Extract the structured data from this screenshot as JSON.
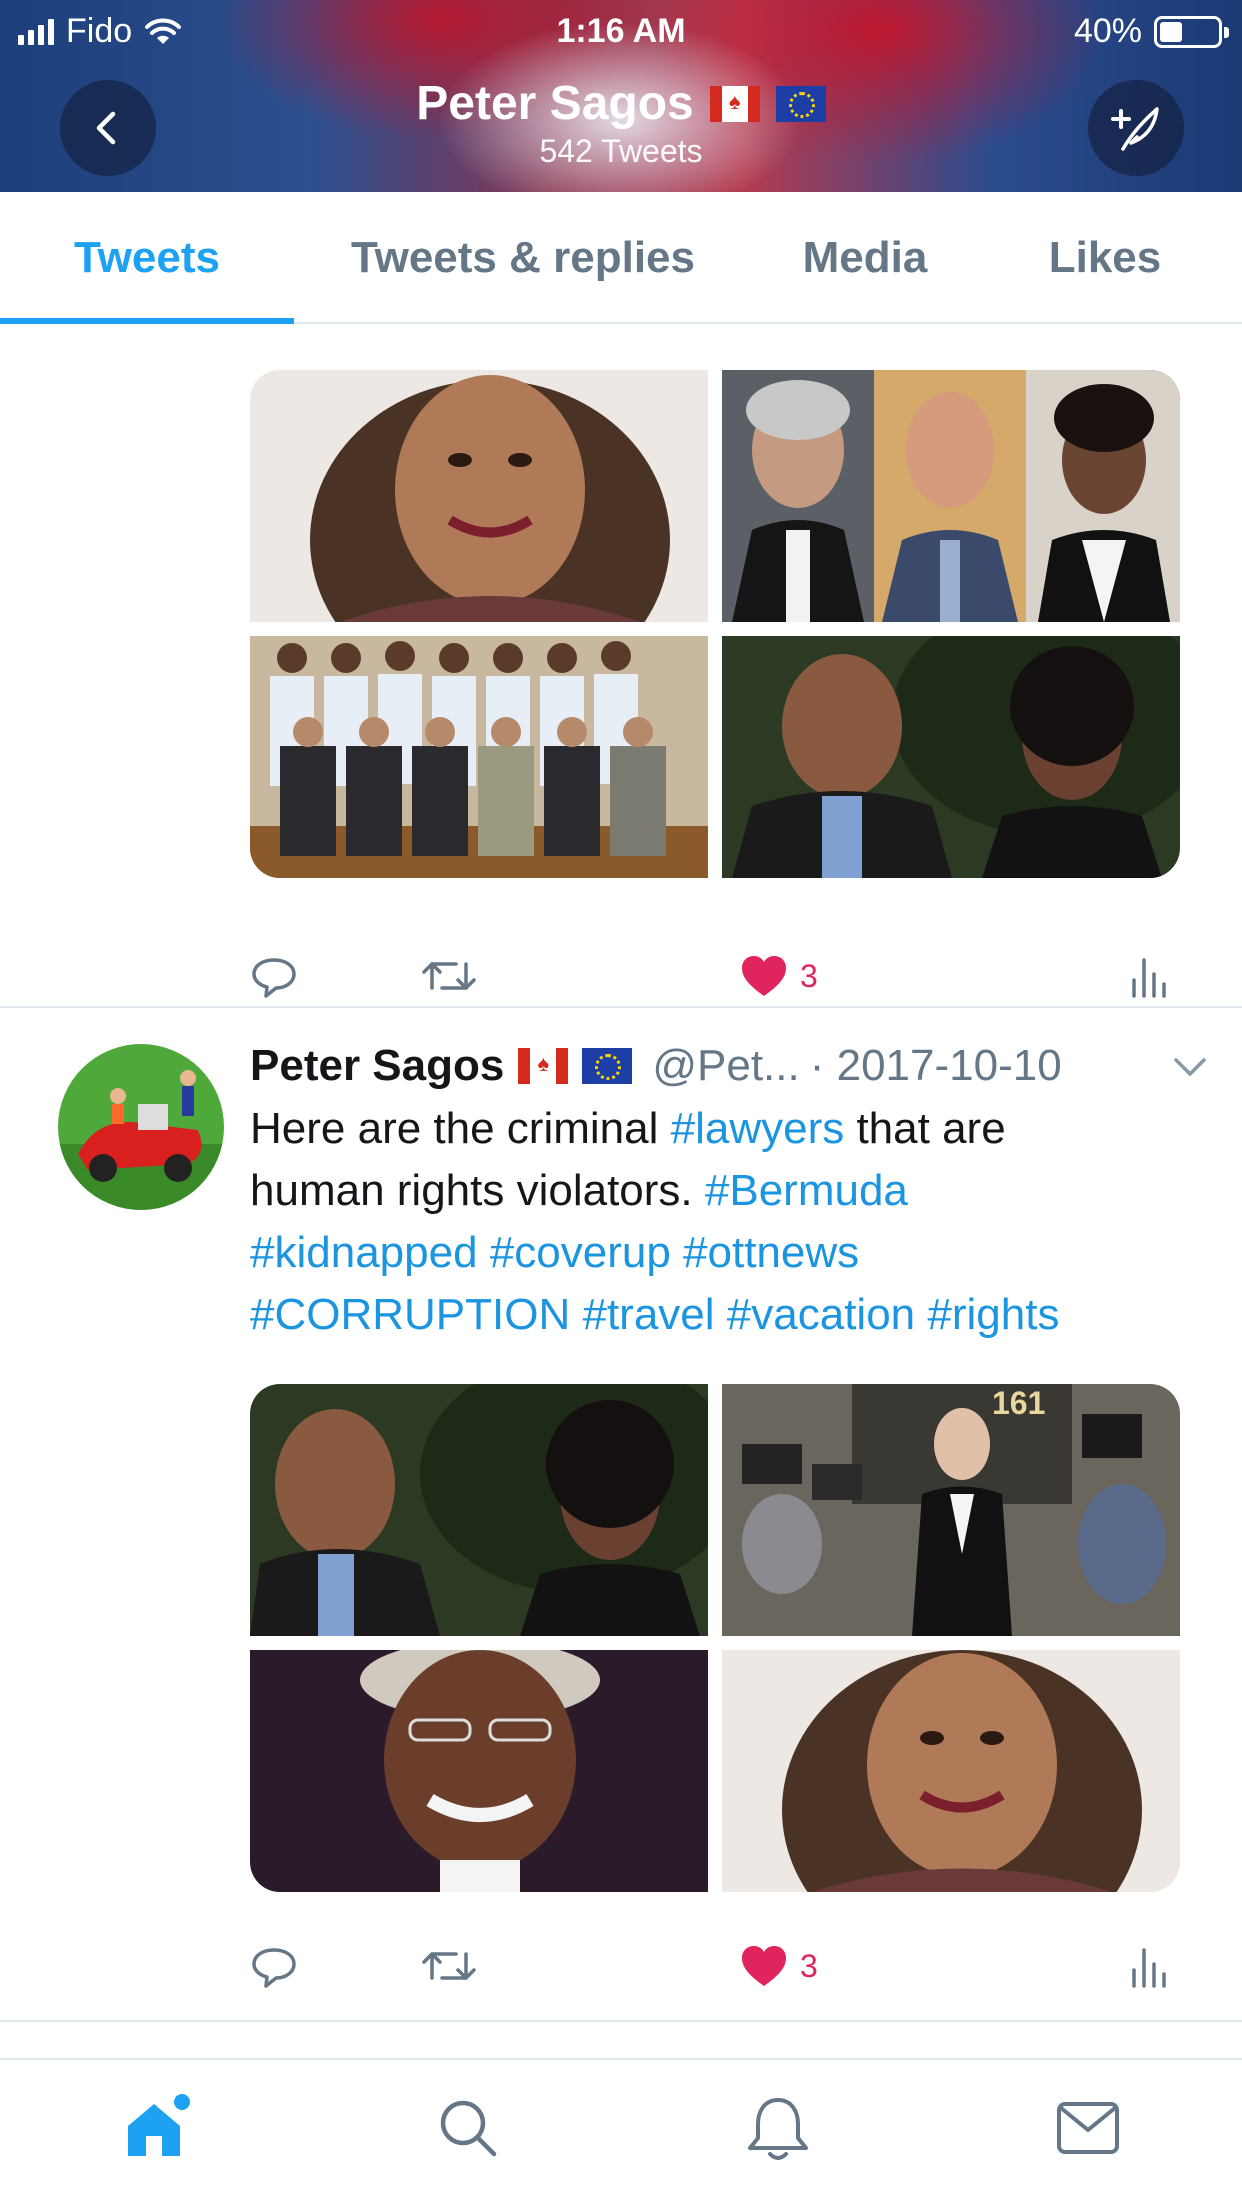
{
  "status_bar": {
    "carrier": "Fido",
    "time": "1:16 AM",
    "battery_percent": "40%",
    "battery_level": 0.4,
    "icons": [
      "signal-icon",
      "wifi-icon",
      "battery-icon"
    ]
  },
  "header": {
    "name": "Peter Sagos",
    "flags": [
      "canada-flag-icon",
      "eu-flag-icon"
    ],
    "tweet_count": "542 Tweets",
    "back_icon": "chevron-left-icon",
    "compose_icon": "compose-tweet-icon"
  },
  "tabs": [
    {
      "label": "Tweets",
      "active": true
    },
    {
      "label": "Tweets & replies",
      "active": false
    },
    {
      "label": "Media",
      "active": false
    },
    {
      "label": "Likes",
      "active": false
    }
  ],
  "tweets": [
    {
      "photos": [
        "woman-smiling-photo",
        "three-barristers-photo",
        "police-group-photo",
        "man-and-woman-photo"
      ],
      "actions": {
        "reply_icon": "reply-icon",
        "retweet_icon": "retweet-icon",
        "like_icon": "heart-icon",
        "likes": "3",
        "analytics_icon": "analytics-icon"
      }
    },
    {
      "name": "Peter Sagos",
      "handle": "@Pet...",
      "date": "· 2017-10-10",
      "text": {
        "line1_prefix": "Here are the criminal ",
        "tag_lawyers": "#lawyers",
        "line1_suffix": " that are",
        "line2_prefix": "human rights violators. ",
        "tag_bermuda": "#Bermuda",
        "tag_kidnapped": "#kidnapped",
        "tag_coverup": "#coverup",
        "tag_ottnews": "#ottnews",
        "tag_corruption": "#CORRUPTION",
        "tag_travel": "#travel",
        "tag_vacation": "#vacation",
        "tag_rights": "#rights"
      },
      "photos": [
        "man-and-woman-photo",
        "barrister-with-press-photo",
        "judge-in-wig-photo",
        "woman-smiling-photo"
      ],
      "photo_caption_number": "161",
      "actions": {
        "likes": "3"
      }
    }
  ],
  "tabbar": [
    {
      "name": "home-icon",
      "active": true
    },
    {
      "name": "search-icon",
      "active": false
    },
    {
      "name": "notifications-icon",
      "active": false
    },
    {
      "name": "messages-icon",
      "active": false
    }
  ],
  "colors": {
    "accent": "#1da1f2",
    "hashtag": "#1b95e0",
    "like": "#e0245e",
    "muted": "#657786",
    "text": "#14171a"
  }
}
